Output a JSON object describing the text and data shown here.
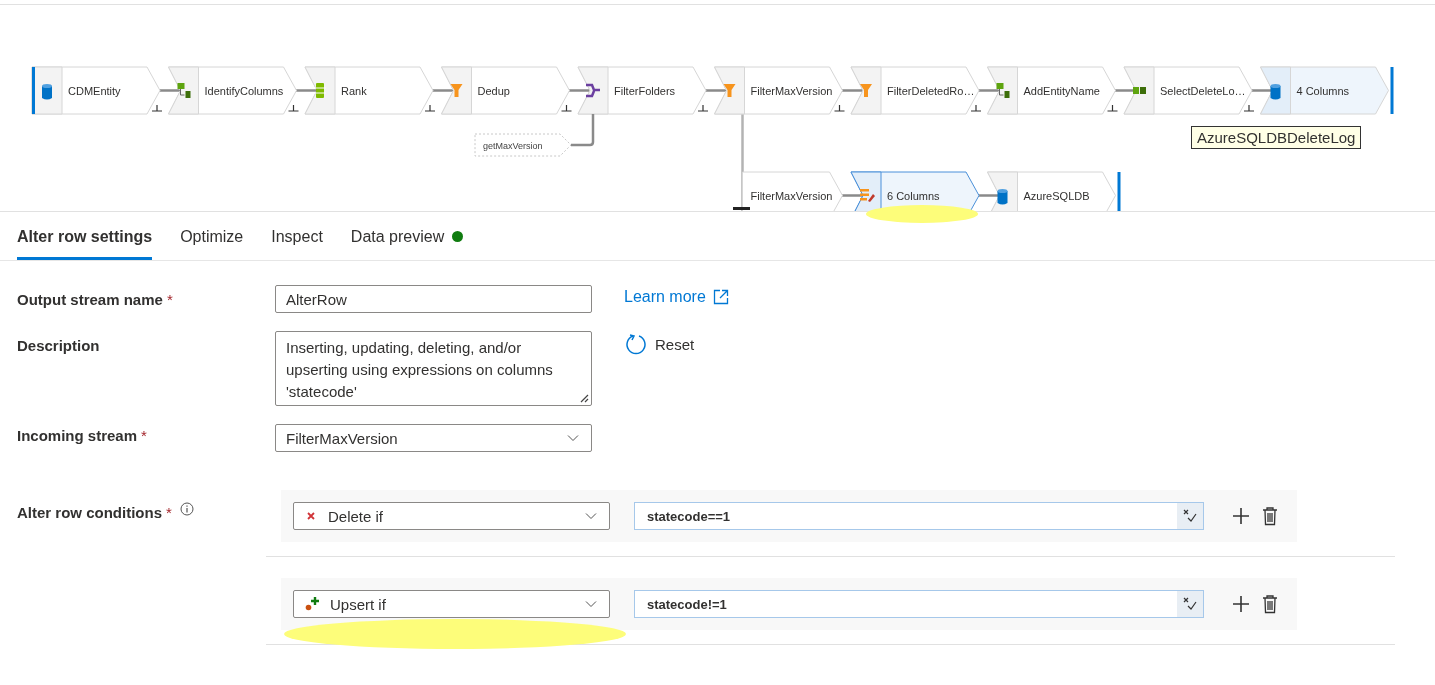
{
  "pipeline": {
    "nodes": [
      {
        "label": "CDMEntity",
        "kind": "source",
        "hovered": false
      },
      {
        "label": "IdentifyColumns",
        "kind": "derive",
        "hovered": false
      },
      {
        "label": "Rank",
        "kind": "rank",
        "hovered": false
      },
      {
        "label": "Dedup",
        "kind": "filter",
        "hovered": false
      },
      {
        "label": "FilterFolders",
        "kind": "exists",
        "hovered": false
      },
      {
        "label": "FilterMaxVersion",
        "kind": "filter",
        "hovered": false
      },
      {
        "label": "FilterDeletedRo…",
        "kind": "filter",
        "hovered": false
      },
      {
        "label": "AddEntityName",
        "kind": "derive",
        "hovered": false
      },
      {
        "label": "SelectDeleteLo…",
        "kind": "select",
        "hovered": false
      },
      {
        "label": "4 Columns",
        "kind": "sink",
        "hovered": true
      }
    ],
    "side_input": "getMaxVersion",
    "tooltip": "AzureSQLDBDeleteLog",
    "branch": [
      {
        "label": "FilterMaxVersion",
        "kind": "reference",
        "selected": false
      },
      {
        "label": "6 Columns",
        "kind": "alter",
        "selected": true
      },
      {
        "label": "AzureSQLDB",
        "kind": "sink",
        "selected": false
      }
    ]
  },
  "tabs": [
    {
      "label": "Alter row settings",
      "selected": true
    },
    {
      "label": "Optimize",
      "selected": false
    },
    {
      "label": "Inspect",
      "selected": false
    },
    {
      "label": "Data preview",
      "selected": false,
      "color": "#107c10"
    }
  ],
  "form": {
    "output_stream_name": {
      "label": "Output stream name",
      "required_mark": "*",
      "value": "AlterRow"
    },
    "learn_more": "Learn more",
    "description": {
      "label": "Description",
      "value": "Inserting, updating, deleting, and/or upserting using expressions on columns 'statecode'"
    },
    "reset": "Reset",
    "incoming_stream": {
      "label": "Incoming stream",
      "required_mark": "*",
      "value": "FilterMaxVersion"
    },
    "conditions_label": "Alter row conditions",
    "conditions_required_mark": "*",
    "conditions": [
      {
        "kind": "delete",
        "action": "Delete if",
        "expression": "statecode==1"
      },
      {
        "kind": "upsert",
        "action": "Upsert if",
        "expression": "statecode!=1"
      }
    ]
  }
}
